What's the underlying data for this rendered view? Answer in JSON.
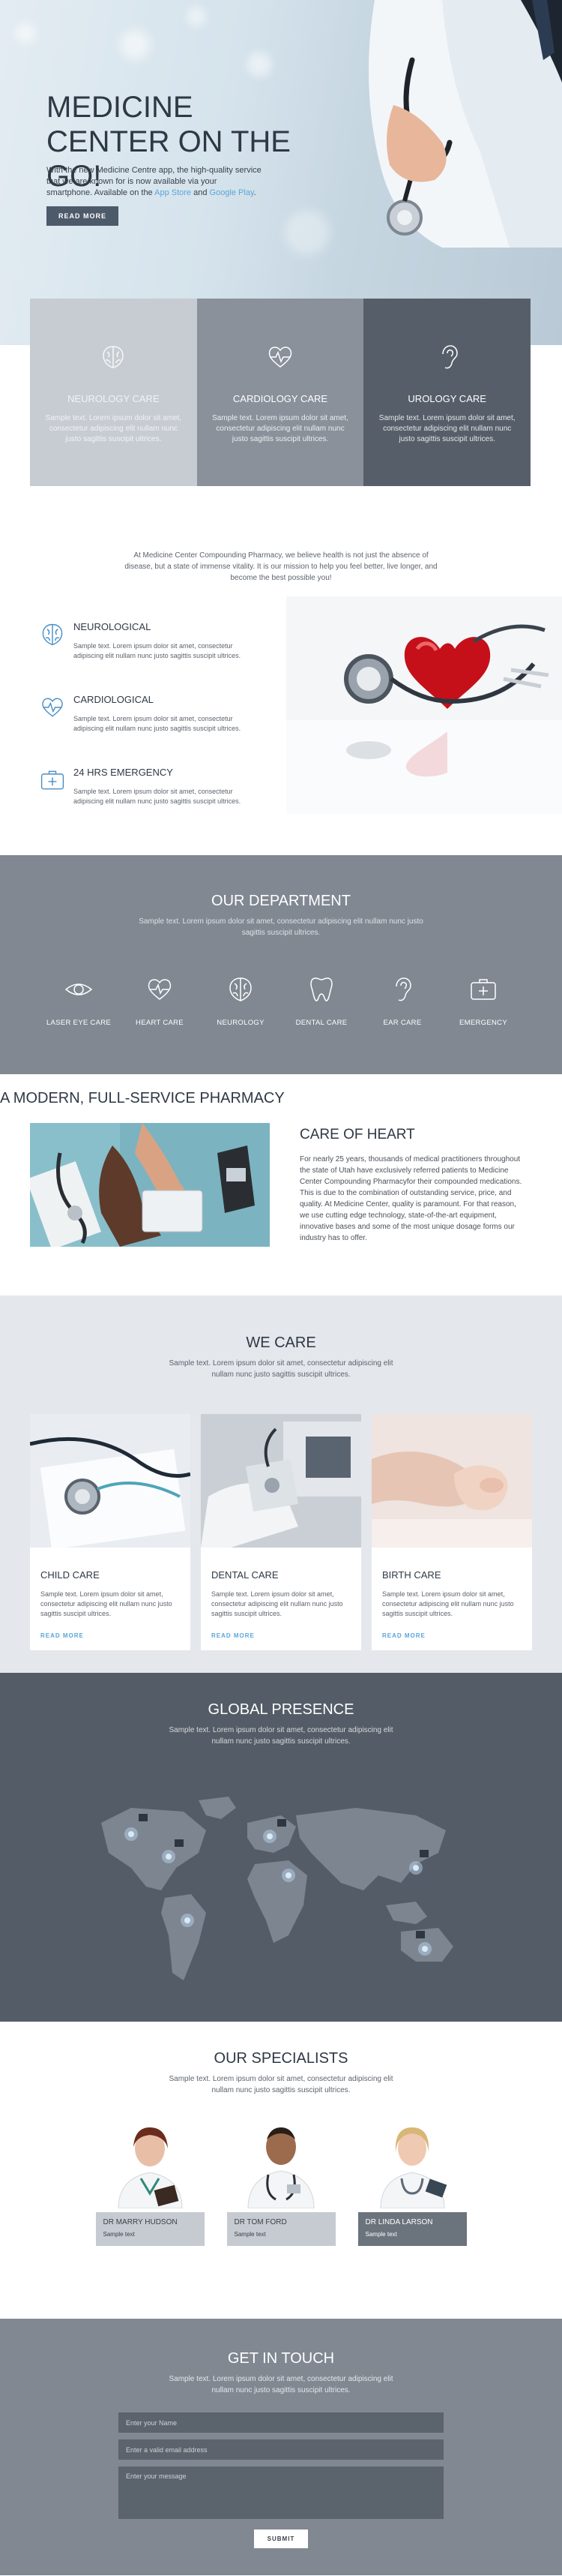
{
  "hero": {
    "title": "MEDICINE CENTER ON THE GO!",
    "text_before": "With the new Medicine Centre app, the high-quality service that we are known for is now available via your smartphone. Available on the ",
    "link_appstore": "App Store",
    "text_and": " and ",
    "link_googleplay": "Google Play",
    "text_end": ".",
    "button": "READ MORE"
  },
  "services": [
    {
      "icon": "brain-icon",
      "title": "NEUROLOGY CARE",
      "text": "Sample text. Lorem ipsum dolor sit amet, consectetur adipiscing elit nullam nunc justo sagittis suscipit ultrices."
    },
    {
      "icon": "heartbeat-icon",
      "title": "CARDIOLOGY CARE",
      "text": "Sample text. Lorem ipsum dolor sit amet, consectetur adipiscing elit nullam nunc justo sagittis suscipit ultrices."
    },
    {
      "icon": "ear-icon",
      "title": "UROLOGY CARE",
      "text": "Sample text. Lorem ipsum dolor sit amet, consectetur adipiscing elit nullam nunc justo sagittis suscipit ultrices."
    }
  ],
  "pharmacy": {
    "title": "A MODERN, FULL-SERVICE PHARMACY",
    "text": "At Medicine Center Compounding Pharmacy, we believe health is not just the absence of disease, but a state of immense vitality. It is our mission to help you feel better, live longer, and become the best possible you!",
    "features": [
      {
        "icon": "brain-icon",
        "title": "NEUROLOGICAL",
        "text": "Sample text. Lorem ipsum dolor sit amet, consectetur adipiscing elit nullam nunc justo sagittis suscipit ultrices."
      },
      {
        "icon": "heartbeat-icon",
        "title": "CARDIOLOGICAL",
        "text": "Sample text. Lorem ipsum dolor sit amet, consectetur adipiscing elit nullam nunc justo sagittis suscipit ultrices."
      },
      {
        "icon": "first-aid-kit-icon",
        "title": "24 HRS EMERGENCY",
        "text": "Sample text. Lorem ipsum dolor sit amet, consectetur adipiscing elit nullam nunc justo sagittis suscipit ultrices."
      }
    ]
  },
  "department": {
    "title": "OUR DEPARTMENT",
    "text": "Sample text. Lorem ipsum dolor sit amet, consectetur adipiscing elit nullam nunc justo sagittis suscipit ultrices.",
    "items": [
      {
        "icon": "eye-icon",
        "label": "LASER EYE CARE"
      },
      {
        "icon": "heart-icon",
        "label": "HEART CARE"
      },
      {
        "icon": "brain-icon",
        "label": "NEUROLOGY"
      },
      {
        "icon": "tooth-icon",
        "label": "DENTAL CARE"
      },
      {
        "icon": "ear-icon",
        "label": "EAR CARE"
      },
      {
        "icon": "first-aid-kit-icon",
        "label": "EMERGENCY"
      }
    ]
  },
  "care_heart": {
    "title": "CARE OF HEART",
    "text": "For nearly 25 years, thousands of medical practitioners throughout the state of Utah have exclusively referred patients to Medicine Center Compounding Pharmacyfor their compounded medications. This is due to the combination of outstanding service, price, and quality. At Medicine Center, quality is paramount. For that reason, we use cutting edge technology, state-of-the-art equipment, innovative bases and some of the most unique dosage forms our industry has to offer."
  },
  "we_care": {
    "title": "WE CARE",
    "text": "Sample text. Lorem ipsum dolor sit amet, consectetur adipiscing elit nullam nunc justo sagittis suscipit ultrices.",
    "cards": [
      {
        "title": "CHILD CARE",
        "text": "Sample text. Lorem ipsum dolor sit amet, consectetur adipiscing elit nullam nunc justo sagittis suscipit ultrices.",
        "link": "READ MORE"
      },
      {
        "title": "DENTAL CARE",
        "text": "Sample text. Lorem ipsum dolor sit amet, consectetur adipiscing elit nullam nunc justo sagittis suscipit ultrices.",
        "link": "READ MORE"
      },
      {
        "title": "BIRTH CARE",
        "text": "Sample text. Lorem ipsum dolor sit amet, consectetur adipiscing elit nullam nunc justo sagittis suscipit ultrices.",
        "link": "READ MORE"
      }
    ]
  },
  "global": {
    "title": "GLOBAL PRESENCE",
    "text": "Sample text. Lorem ipsum dolor sit amet, consectetur adipiscing elit nullam nunc justo sagittis suscipit ultrices."
  },
  "specialists": {
    "title": "OUR SPECIALISTS",
    "text": "Sample text. Lorem ipsum dolor sit amet, consectetur adipiscing elit nullam nunc justo sagittis suscipit ultrices.",
    "people": [
      {
        "name": "DR MARRY HUDSON",
        "role": "Sample text"
      },
      {
        "name": "DR TOM FORD",
        "role": "Sample text"
      },
      {
        "name": "DR LINDA LARSON",
        "role": "Sample text"
      }
    ]
  },
  "contact": {
    "title": "GET IN TOUCH",
    "text": "Sample text. Lorem ipsum dolor sit amet, consectetur adipiscing elit nullam nunc justo sagittis suscipit ultrices.",
    "name_placeholder": "Enter your Name",
    "email_placeholder": "Enter a valid email address",
    "message_placeholder": "Enter your message",
    "submit": "SUBMIT"
  }
}
